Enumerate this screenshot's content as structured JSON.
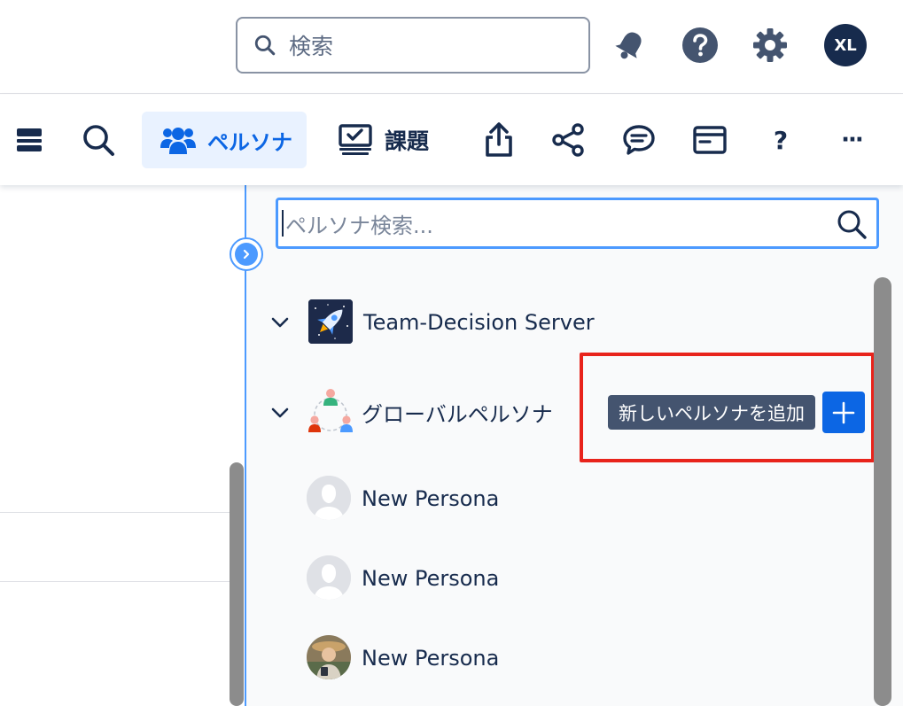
{
  "header": {
    "search_placeholder": "検索",
    "user_initials": "XL",
    "icons": [
      "search-icon",
      "bell-icon",
      "help-icon",
      "gear-icon"
    ]
  },
  "toolbar": {
    "persona_label": "ペルソナ",
    "issue_label": "課題",
    "help_symbol": "?",
    "more_symbol": "···"
  },
  "panel": {
    "search_placeholder": "ペルソナ検索...",
    "tree": [
      {
        "label": "Team-Decision Server",
        "icon": "rocket-icon"
      },
      {
        "label": "グローバルペルソナ",
        "icon": "global-persona-icon",
        "tooltip": "新しいペルソナを追加",
        "children": [
          {
            "label": "New Persona"
          },
          {
            "label": "New Persona"
          },
          {
            "label": "New Persona"
          }
        ]
      }
    ]
  },
  "colors": {
    "accent": "#0c66e4",
    "active_bg": "#e9f2ff",
    "focus": "#4c9aff",
    "highlight": "#e8231b",
    "tooltip_bg": "#44546f",
    "text": "#172b4d"
  }
}
